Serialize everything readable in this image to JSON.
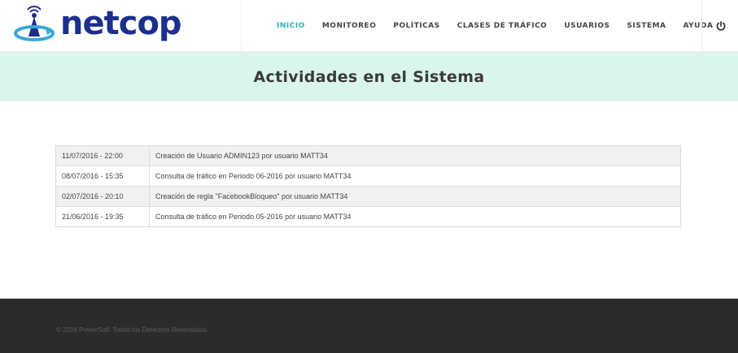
{
  "brand": {
    "name": "netcop"
  },
  "nav": {
    "items": [
      {
        "label": "INICIO",
        "active": true
      },
      {
        "label": "MONITOREO",
        "active": false
      },
      {
        "label": "POLÍTICAS",
        "active": false
      },
      {
        "label": "CLASES DE TRÁFICO",
        "active": false
      },
      {
        "label": "USUARIOS",
        "active": false
      },
      {
        "label": "SISTEMA",
        "active": false
      },
      {
        "label": "AYUDA",
        "active": false
      }
    ],
    "power_icon": "power-icon"
  },
  "page": {
    "title": "Actividades en el Sistema"
  },
  "activities": [
    {
      "date": "11/07/2016 - 22:00",
      "description": "Creación de Usuario ADMIN123 por usuario MATT34"
    },
    {
      "date": "08/07/2016 - 15:35",
      "description": "Consulta de tráfico en Periodo 06-2016 por usuario MATT34"
    },
    {
      "date": "02/07/2016 - 20:10",
      "description": "Creación de regla \"FacebookBloqueo\" por usuario MATT34"
    },
    {
      "date": "21/06/2016 - 19:35",
      "description": "Consulta de tráfico en Periodo 05-2016 por usuario MATT34"
    }
  ],
  "footer": {
    "text": "© 2016 PowerSoft. Todos los Derechos Reservados."
  },
  "colors": {
    "accent": "#2bb6a8",
    "brand": "#1d2f8c",
    "banner_bg": "#daf5ec",
    "footer_bg": "#2b2b2b"
  }
}
